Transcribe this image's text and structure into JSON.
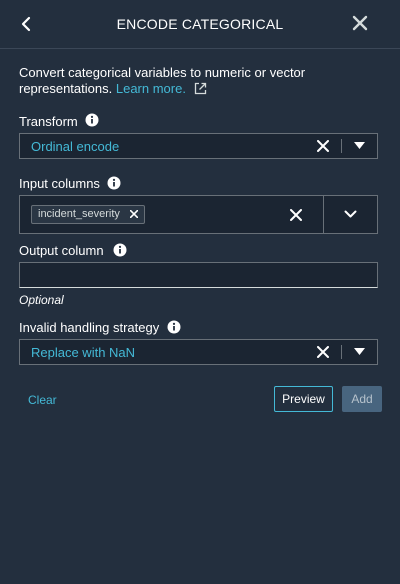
{
  "header": {
    "title": "ENCODE CATEGORICAL"
  },
  "description": {
    "text": "Convert categorical variables to numeric or vector representations.",
    "learn_more": "Learn more."
  },
  "transform": {
    "label": "Transform",
    "value": "Ordinal encode"
  },
  "input_columns": {
    "label": "Input columns",
    "tokens": [
      "incident_severity"
    ]
  },
  "output_column": {
    "label": "Output column",
    "value": "",
    "hint": "Optional"
  },
  "invalid_handling": {
    "label": "Invalid handling strategy",
    "value": "Replace with NaN"
  },
  "actions": {
    "clear": "Clear",
    "preview": "Preview",
    "add": "Add"
  },
  "colors": {
    "background": "#232f3e",
    "accent": "#44b9d6",
    "field_bg": "#1b2532",
    "border": "#687078",
    "add_bg": "#48657f"
  }
}
